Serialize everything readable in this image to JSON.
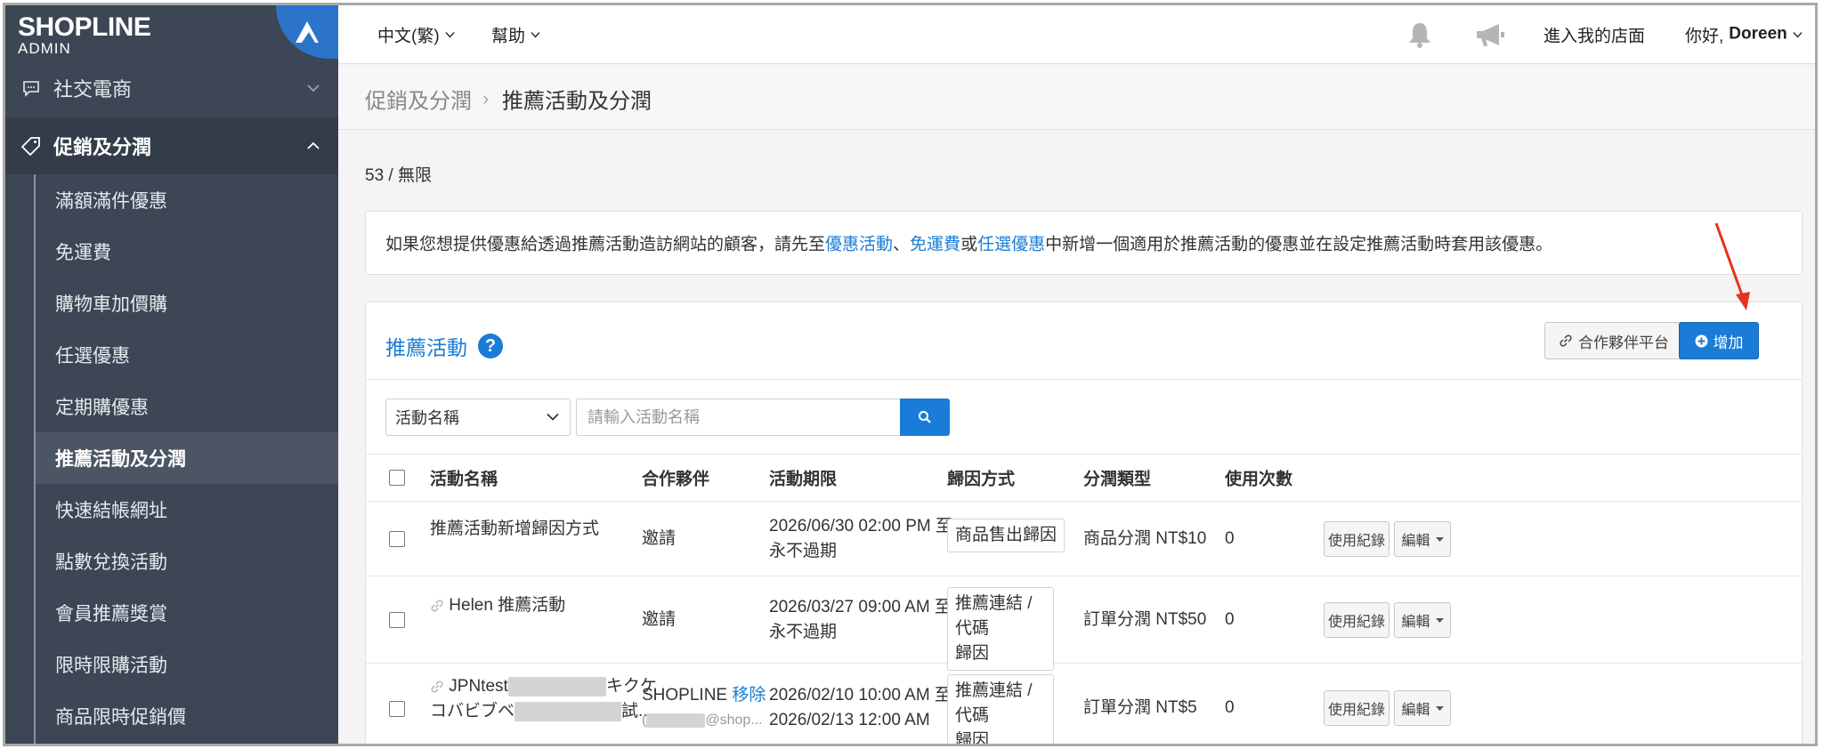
{
  "brand": {
    "name": "SHOPLINE",
    "sub": "ADMIN"
  },
  "sidebar": {
    "social": "社交電商",
    "promo": "促銷及分潤",
    "items": [
      "滿額滿件優惠",
      "免運費",
      "購物車加價購",
      "任選優惠",
      "定期購優惠",
      "推薦活動及分潤",
      "快速結帳網址",
      "點數兌換活動",
      "會員推薦獎賞",
      "限時限購活動",
      "商品限時促銷價"
    ],
    "active_index": 5
  },
  "topbar": {
    "language": "中文(繁)",
    "help": "幫助",
    "store": "進入我的店面",
    "greeting": "你好,",
    "user": "Doreen"
  },
  "breadcrumb": {
    "parent": "促銷及分潤",
    "current": "推薦活動及分潤"
  },
  "quota": "53 / 無限",
  "notice": {
    "before": "如果您想提供優惠給透過推薦活動造訪網站的顧客，請先至",
    "link1": "優惠活動",
    "sep1": "、",
    "link2": "免運費",
    "sep2": "或",
    "link3": "任選優惠",
    "after": "中新增一個適用於推薦活動的優惠並在設定推薦活動時套用該優惠。"
  },
  "panel": {
    "title": "推薦活動",
    "partner_button": "合作夥伴平台",
    "add_button": "增加",
    "filter_select": "活動名稱",
    "search_placeholder": "請輸入活動名稱"
  },
  "table": {
    "columns": [
      "活動名稱",
      "合作夥伴",
      "活動期限",
      "歸因方式",
      "分潤類型",
      "使用次數"
    ],
    "rows": [
      {
        "name": "推薦活動新增歸因方式",
        "partner": "邀請",
        "partner_link": "",
        "period1": "2026/06/30 02:00 PM 至",
        "period2": "永不過期",
        "attr1": "商品售出歸因",
        "attr2": "",
        "share": "商品分潤 NT$10",
        "uses": "0"
      },
      {
        "name": "Helen 推薦活動",
        "partner": "邀請",
        "partner_link": "",
        "period1": "2026/03/27 09:00 AM 至",
        "period2": "永不過期",
        "attr1": "推薦連結 / 代碼",
        "attr2": "歸因",
        "share": "訂單分潤 NT$50",
        "uses": "0"
      },
      {
        "name": "JPNtest",
        "name_tail1": "キクケ",
        "name_line2a": "コバビブベ",
        "name_tail2": "試...",
        "partner": "SHOPLINE",
        "partner_link": "移除",
        "partner_email": "@shop...",
        "period1": "2026/02/10 10:00 AM 至",
        "period2": "2026/02/13 12:00 AM",
        "attr1": "推薦連結 / 代碼",
        "attr2": "歸因",
        "share": "訂單分潤 NT$5",
        "uses": "0"
      }
    ],
    "log_button": "使用紀錄",
    "edit_button": "編輯"
  },
  "colors": {
    "accent": "#1a7cd6",
    "sidebar": "#3c4654",
    "arrow": "#e8321f"
  }
}
